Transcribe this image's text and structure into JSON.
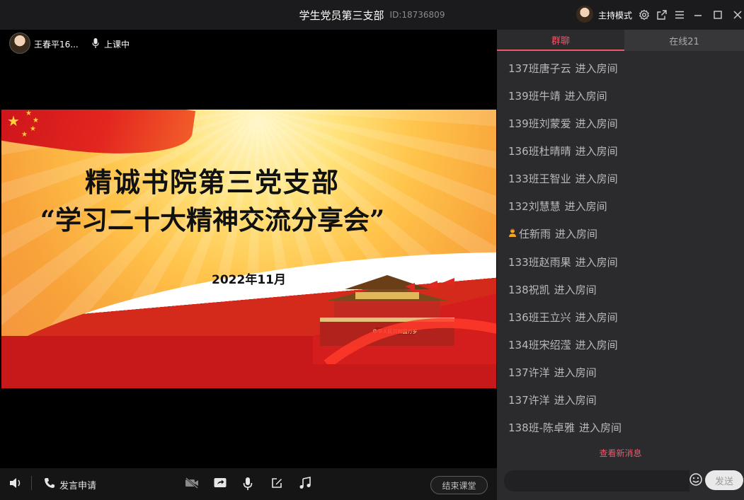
{
  "window": {
    "title": "学生党员第三支部",
    "room_id": "ID:18736809",
    "host_mode_label": "主持模式"
  },
  "stage": {
    "user_name": "王春平16...",
    "class_status": "上课中",
    "slide": {
      "title_line1": "精诚书院第三党支部",
      "title_line2": "“学习二十大精神交流分享会”",
      "date": "2022年11月",
      "banner_text": "中华人民共和国万岁"
    }
  },
  "toolbar": {
    "speak_request_label": "发言申请",
    "end_class_label": "结束课堂",
    "icons": [
      "speaker-icon",
      "phone-icon",
      "camera-off-icon",
      "screen-share-icon",
      "microphone-icon",
      "edit-icon",
      "music-icon"
    ]
  },
  "chat": {
    "tabs": [
      {
        "label": "群聊",
        "active": true
      },
      {
        "label": "在线21",
        "active": false
      }
    ],
    "messages": [
      {
        "name": "137班唐子云",
        "action": "进入房间",
        "has_icon": false
      },
      {
        "name": "139班牛靖",
        "action": "进入房间",
        "has_icon": false
      },
      {
        "name": "139班刘蒙爱",
        "action": "进入房间",
        "has_icon": false
      },
      {
        "name": "136班杜晴晴",
        "action": "进入房间",
        "has_icon": false
      },
      {
        "name": "133班王智业",
        "action": "进入房间",
        "has_icon": false
      },
      {
        "name": "132刘慧慧",
        "action": "进入房间",
        "has_icon": false
      },
      {
        "name": "任新雨",
        "action": "进入房间",
        "has_icon": true
      },
      {
        "name": "133班赵雨果",
        "action": "进入房间",
        "has_icon": false
      },
      {
        "name": "138祝凯",
        "action": "进入房间",
        "has_icon": false
      },
      {
        "name": "136班王立兴",
        "action": "进入房间",
        "has_icon": false
      },
      {
        "name": "134班宋绍滢",
        "action": "进入房间",
        "has_icon": false
      },
      {
        "name": "137许洋",
        "action": "进入房间",
        "has_icon": false
      },
      {
        "name": "137许洋",
        "action": "进入房间",
        "has_icon": false
      },
      {
        "name": "138班-陈卓雅",
        "action": "进入房间",
        "has_icon": false
      }
    ],
    "new_messages_label": "查看新消息",
    "input_placeholder": "",
    "send_label": "发送"
  },
  "colors": {
    "accent": "#f0566a",
    "panel_bg": "#2b2b2e",
    "titlebar_bg": "#1b1b1d"
  }
}
